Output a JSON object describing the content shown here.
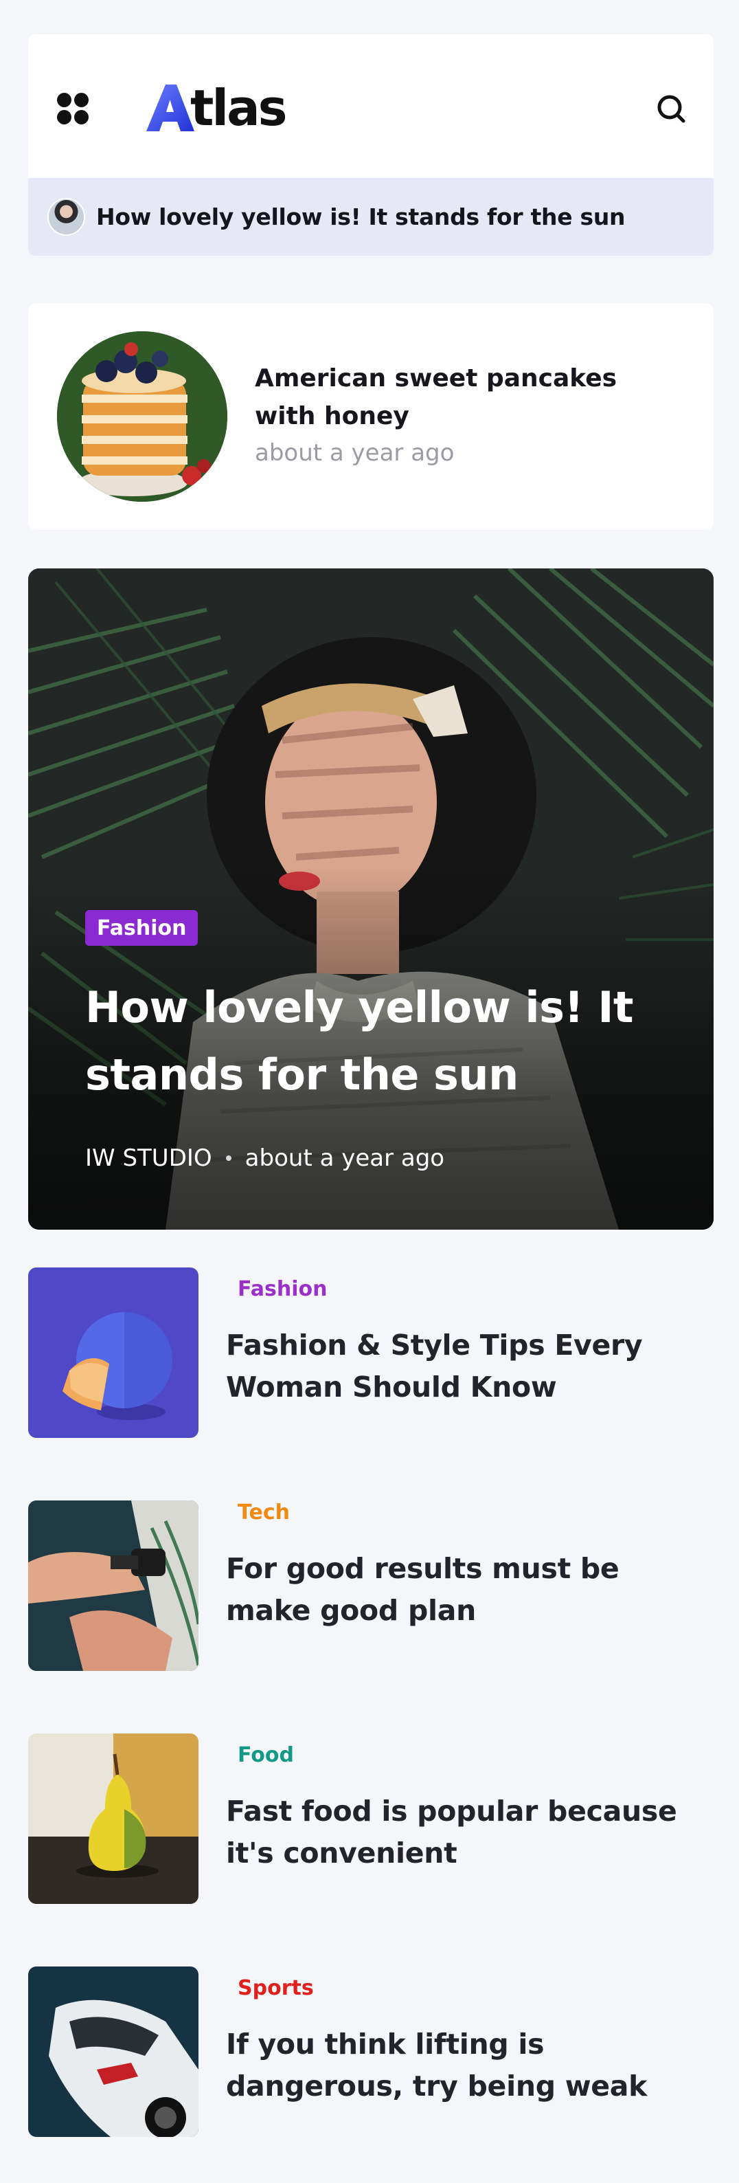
{
  "app": {
    "logo_text": "tlas",
    "logo_accent": "#3d5cf0"
  },
  "ticker": {
    "text": "How lovely yellow is! It stands for the sun"
  },
  "featured_small": {
    "title": "American sweet pancakes with honey",
    "time": "about a year ago"
  },
  "hero": {
    "category": "Fashion",
    "category_color": "#8a2bd1",
    "title": "How lovely yellow is! It stands for the sun",
    "author": "IW STUDIO",
    "time": "about a year ago"
  },
  "articles": [
    {
      "category": "Fashion",
      "category_color": "#9b30c8",
      "title": "Fashion & Style Tips Every Woman Should Know"
    },
    {
      "category": "Tech",
      "category_color": "#f08a12",
      "title": "For good results must be make good plan"
    },
    {
      "category": "Food",
      "category_color": "#139a87",
      "title": "Fast food is popular because it's convenient"
    },
    {
      "category": "Sports",
      "category_color": "#e0201c",
      "title": "If you think lifting is dangerous, try being weak"
    }
  ]
}
